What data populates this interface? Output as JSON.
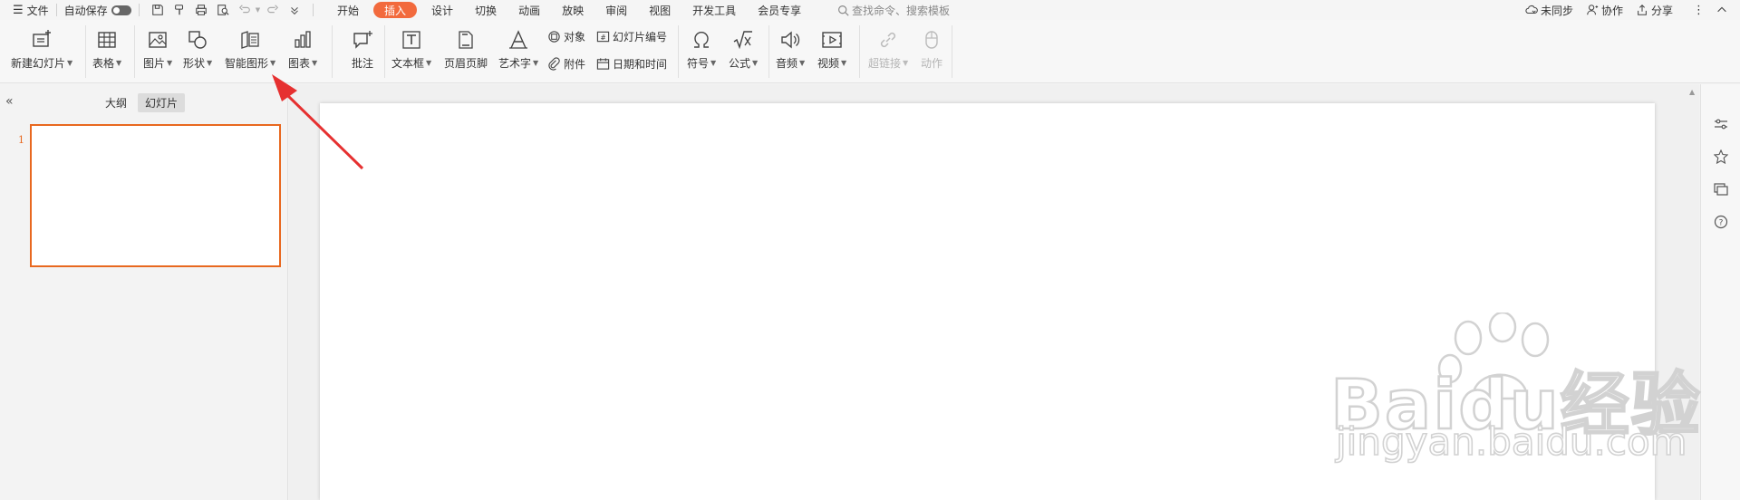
{
  "menubar": {
    "file_label": "文件",
    "autosave_label": "自动保存",
    "tabs": [
      "开始",
      "插入",
      "设计",
      "切换",
      "动画",
      "放映",
      "审阅",
      "视图",
      "开发工具",
      "会员专享"
    ],
    "active_tab": "插入",
    "search_placeholder": "查找命令、搜索模板",
    "right": {
      "sync_label": "未同步",
      "collab_label": "协作",
      "share_label": "分享"
    }
  },
  "ribbon": {
    "new_slide": "新建幻灯片",
    "table": "表格",
    "picture": "图片",
    "shape": "形状",
    "smartart": "智能图形",
    "chart": "图表",
    "comment": "批注",
    "textbox": "文本框",
    "header_footer": "页眉页脚",
    "wordart": "艺术字",
    "object": "对象",
    "slide_number": "幻灯片编号",
    "attachment": "附件",
    "datetime": "日期和时间",
    "symbol": "符号",
    "formula": "公式",
    "audio": "音频",
    "video": "视频",
    "hyperlink": "超链接",
    "action": "动作"
  },
  "leftpanel": {
    "tab_outline": "大纲",
    "tab_slides": "幻灯片",
    "slide_number": "1"
  },
  "watermark": {
    "brand": "Baidu经验",
    "url": "jingyan.baidu.com"
  },
  "colors": {
    "accent": "#f26a3d",
    "selection": "#e8681f",
    "arrow": "#e63030"
  }
}
